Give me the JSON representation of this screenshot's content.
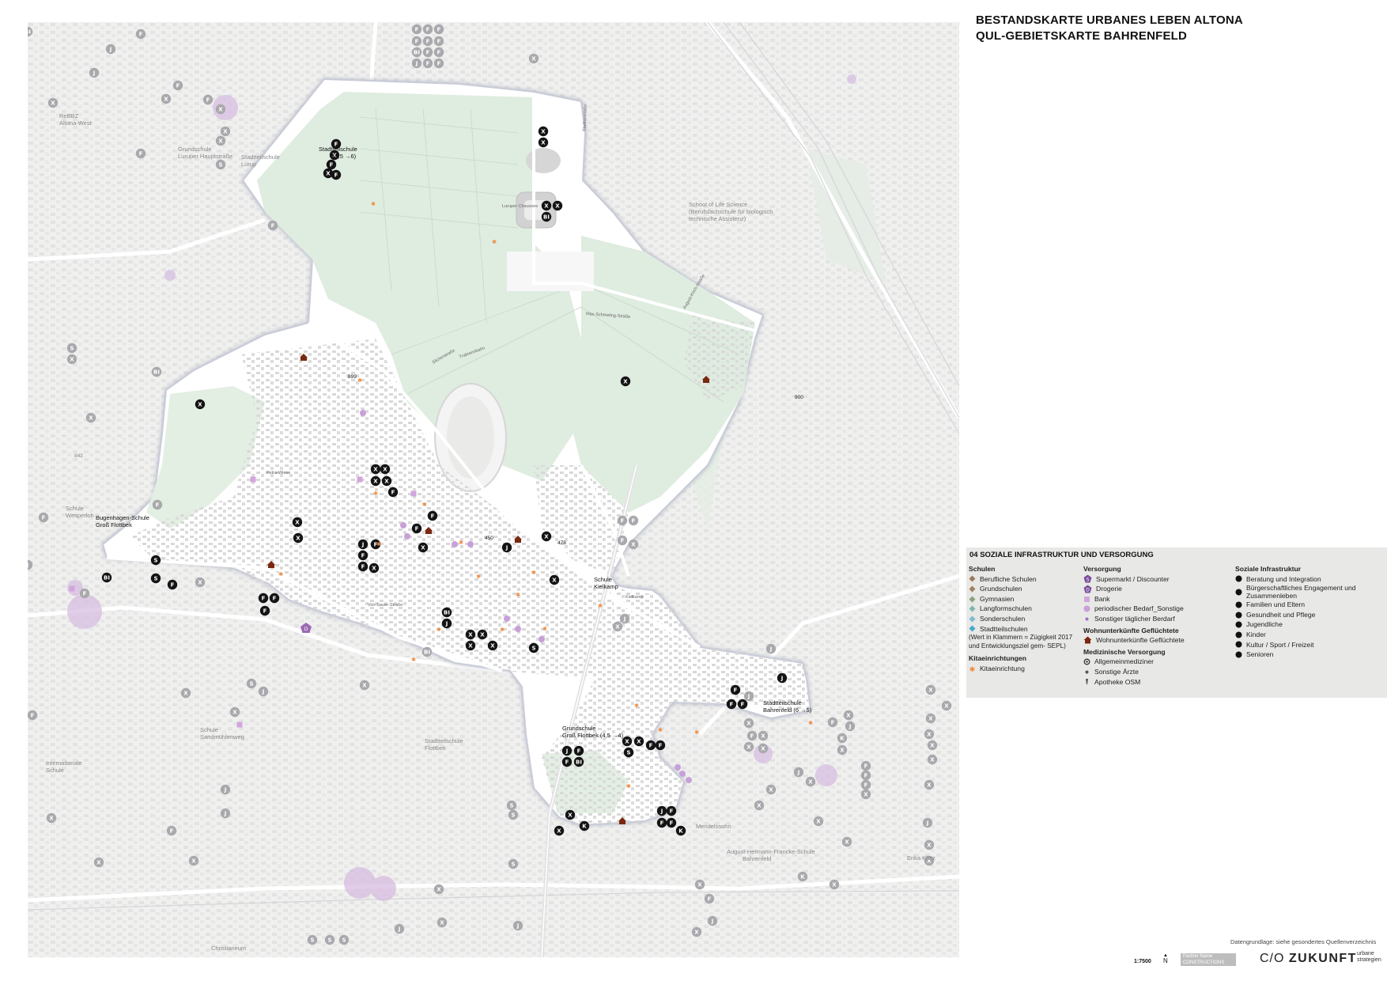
{
  "title": {
    "line1": "BESTANDSKARTE URBANES LEBEN ALTONA",
    "line2": "QUL-GEBIETSKARTE BAHRENFELD"
  },
  "legend": {
    "title": "04 SOZIALE INFRASTRUKTUR UND VERSORGUNG",
    "schulen": {
      "heading": "Schulen",
      "items": [
        {
          "label": "Berufliche Schulen",
          "color": "#9a7a5c",
          "shape": "diamond"
        },
        {
          "label": "Grundschulen",
          "color": "#a08060",
          "shape": "diamond"
        },
        {
          "label": "Gymnasien",
          "color": "#8ea07c",
          "shape": "diamond"
        },
        {
          "label": "Langformschulen",
          "color": "#7fb6b0",
          "shape": "diamond"
        },
        {
          "label": "Sonderschulen",
          "color": "#7fbad0",
          "shape": "diamond"
        },
        {
          "label": "Stadtteilschulen",
          "color": "#48a8c8",
          "shape": "diamond"
        }
      ],
      "note": "(Wert in Klammern = Zügigkeit 2017 und Entwicklungsziel gem- SEPL)"
    },
    "kita": {
      "heading": "Kitaeinrichtungen",
      "items": [
        {
          "label": "Kitaeinrichtung",
          "color": "#f08a3c",
          "shape": "star"
        }
      ]
    },
    "versorgung": {
      "heading": "Versorgung",
      "items": [
        {
          "label": "Supermarkt / Discounter",
          "color": "#7a4e9a",
          "shape": "pentagon"
        },
        {
          "label": "Drogerie",
          "color": "#7a4e9a",
          "shape": "pentagon-d"
        },
        {
          "label": "Bank",
          "color": "#d2a6dc",
          "shape": "square"
        },
        {
          "label": "periodischer Bedarf_Sonstige",
          "color": "#c8a0d8",
          "shape": "circle"
        },
        {
          "label": "Sonstiger täglicher Berdarf",
          "color": "#a070c0",
          "shape": "dot"
        }
      ]
    },
    "wohn": {
      "heading": "Wohnunterkünfte Geflüchtete",
      "items": [
        {
          "label": "Wohnunterkünfte Geflüchtete",
          "color": "#7a2810",
          "shape": "house"
        }
      ]
    },
    "medizin": {
      "heading": "Medizinische Versorgung",
      "items": [
        {
          "label": "Allgemeinmediziner",
          "color": "#333333",
          "shape": "ring"
        },
        {
          "label": "Sonstige Ärzte",
          "color": "#555555",
          "shape": "dot"
        },
        {
          "label": "Apotheke OSM",
          "color": "#555555",
          "shape": "tick"
        }
      ]
    },
    "sozial": {
      "heading": "Soziale Infrastruktur",
      "items": [
        {
          "label": "Beratung und Integration",
          "color": "#111111"
        },
        {
          "label": "Bürgerschaftliches Engagement und Zusammenleben",
          "color": "#111111"
        },
        {
          "label": "Familien und Eltern",
          "color": "#111111"
        },
        {
          "label": "Gesundheit und Pflege",
          "color": "#111111"
        },
        {
          "label": "Jugendliche",
          "color": "#111111"
        },
        {
          "label": "Kinder",
          "color": "#111111"
        },
        {
          "label": "Kultur / Sport / Freizeit",
          "color": "#111111"
        },
        {
          "label": "Senioren",
          "color": "#111111"
        }
      ]
    }
  },
  "footer": {
    "source": "Datengrundlage: siehe gesondertes Quellenverzeichnis",
    "scale": "1:7500",
    "north": "N",
    "brand_prefix": "C/O",
    "brand_name": "ZUKUNFT",
    "brand_sub1": "urbane",
    "brand_sub2": "strategien",
    "partner": "Partner Name CONSTRUCTIONS"
  },
  "map_labels": {
    "stadtteilschule_north": "Stadtteilschule",
    "stadtteilschule_north_val": "(5,5 →6)",
    "bugenhagen": "Bugenhagen-Schule",
    "gross_flottbek": "Groß Flottbek",
    "schule_kielkamp": "Schule",
    "kielkamp": "Kielkamp",
    "grundschule_gf": "Grundschule",
    "grundschule_gf_val": "Groß Flottbek (4,5 →4)",
    "stadtteilschule_bf": "Stadtteilschule",
    "stadtteilschule_bf_val": "Bahrenfeld (6 →5)",
    "num_899": "899",
    "num_900": "900",
    "num_450": "450",
    "num_478": "478",
    "num_842": "842",
    "gray_rebbz": "ReBBZ",
    "gray_altona_west": "Altona-West",
    "gray_grundschule_lurup": "Grundschule",
    "gray_luruper": "Luruper Hauptstraße",
    "gray_stadtteilschule": "Stadtteilschule",
    "gray_lurup": "Lurup",
    "gray_school_life": "School of Life Science",
    "gray_school_life2": "(Berufsfachschule für biologisch",
    "gray_school_life3": "technische Assistenz)",
    "gray_schule_waesper": "Schule",
    "gray_waesperloh": "Wesperloh",
    "gray_schule_sand": "Schule",
    "gray_sandmuehlenweg": "Sandmühlenweg",
    "gray_international": "Internationale",
    "gray_schule": "Schule",
    "gray_stadtteilschule_flottbek": "Stadtteilschule",
    "gray_flottbek": "Flottbek",
    "gray_august": "August-Hermann-Francke-Schule",
    "gray_bahrenfeld": "Bahrenfeld",
    "gray_christianeum": "Christianeum",
    "gray_erika": "Erika Klütz",
    "gray_schule_mendelssohn": "Mendelssohn",
    "street_max_schmeling": "Max-Schmeling-Straße",
    "street_august_kirch": "August-Kirch-Straße",
    "street_stadionstrasse": "Stadionstraße",
    "street_von_sauer": "Von-Sauer-Straße",
    "street_silcherstrasse": "Silcherstraße",
    "street_trabrennbahn": "Trabrennbahn",
    "street_luruper_chaussee": "Luruper Chaussee",
    "street_kielkamp": "Kielkamp",
    "street_petra_wiese": "Petra-Wiese"
  }
}
